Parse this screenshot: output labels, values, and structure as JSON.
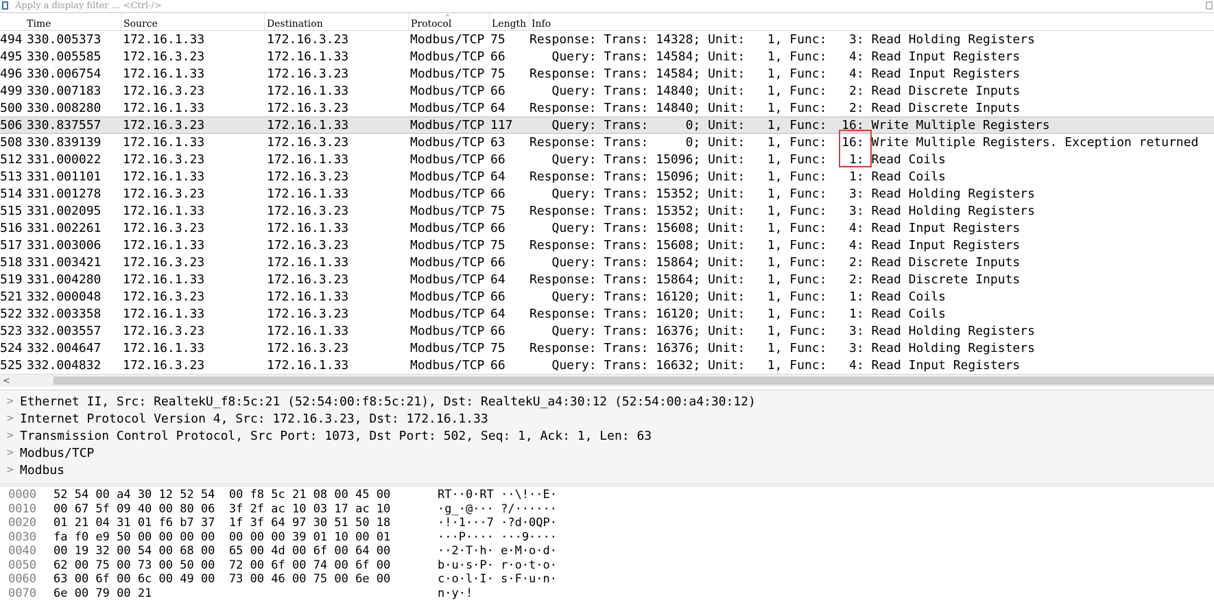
{
  "filter": {
    "placeholder": "Apply a display filter … <Ctrl-/>"
  },
  "columns": [
    "Time",
    "Source",
    "Destination",
    "Protocol",
    "Length",
    "Info"
  ],
  "sort_indicator": "^",
  "packets": [
    {
      "no": "494",
      "time": "330.005373",
      "src": "172.16.1.33",
      "dst": "172.16.3.23",
      "proto": "Modbus/TCP",
      "len": "75",
      "info": "Response: Trans: 14328; Unit:   1, Func:   3: Read Holding Registers"
    },
    {
      "no": "495",
      "time": "330.005585",
      "src": "172.16.3.23",
      "dst": "172.16.1.33",
      "proto": "Modbus/TCP",
      "len": "66",
      "info": "   Query: Trans: 14584; Unit:   1, Func:   4: Read Input Registers"
    },
    {
      "no": "496",
      "time": "330.006754",
      "src": "172.16.1.33",
      "dst": "172.16.3.23",
      "proto": "Modbus/TCP",
      "len": "75",
      "info": "Response: Trans: 14584; Unit:   1, Func:   4: Read Input Registers"
    },
    {
      "no": "499",
      "time": "330.007183",
      "src": "172.16.3.23",
      "dst": "172.16.1.33",
      "proto": "Modbus/TCP",
      "len": "66",
      "info": "   Query: Trans: 14840; Unit:   1, Func:   2: Read Discrete Inputs"
    },
    {
      "no": "500",
      "time": "330.008280",
      "src": "172.16.1.33",
      "dst": "172.16.3.23",
      "proto": "Modbus/TCP",
      "len": "64",
      "info": "Response: Trans: 14840; Unit:   1, Func:   2: Read Discrete Inputs"
    },
    {
      "no": "506",
      "time": "330.837557",
      "src": "172.16.3.23",
      "dst": "172.16.1.33",
      "proto": "Modbus/TCP",
      "len": "117",
      "info": "   Query: Trans:     0; Unit:   1, Func:  16: Write Multiple Registers",
      "selected": true
    },
    {
      "no": "508",
      "time": "330.839139",
      "src": "172.16.1.33",
      "dst": "172.16.3.23",
      "proto": "Modbus/TCP",
      "len": "63",
      "info": "Response: Trans:     0; Unit:   1, Func:  16: Write Multiple Registers. Exception returned"
    },
    {
      "no": "512",
      "time": "331.000022",
      "src": "172.16.3.23",
      "dst": "172.16.1.33",
      "proto": "Modbus/TCP",
      "len": "66",
      "info": "   Query: Trans: 15096; Unit:   1, Func:   1: Read Coils"
    },
    {
      "no": "513",
      "time": "331.001101",
      "src": "172.16.1.33",
      "dst": "172.16.3.23",
      "proto": "Modbus/TCP",
      "len": "64",
      "info": "Response: Trans: 15096; Unit:   1, Func:   1: Read Coils"
    },
    {
      "no": "514",
      "time": "331.001278",
      "src": "172.16.3.23",
      "dst": "172.16.1.33",
      "proto": "Modbus/TCP",
      "len": "66",
      "info": "   Query: Trans: 15352; Unit:   1, Func:   3: Read Holding Registers"
    },
    {
      "no": "515",
      "time": "331.002095",
      "src": "172.16.1.33",
      "dst": "172.16.3.23",
      "proto": "Modbus/TCP",
      "len": "75",
      "info": "Response: Trans: 15352; Unit:   1, Func:   3: Read Holding Registers"
    },
    {
      "no": "516",
      "time": "331.002261",
      "src": "172.16.3.23",
      "dst": "172.16.1.33",
      "proto": "Modbus/TCP",
      "len": "66",
      "info": "   Query: Trans: 15608; Unit:   1, Func:   4: Read Input Registers"
    },
    {
      "no": "517",
      "time": "331.003006",
      "src": "172.16.1.33",
      "dst": "172.16.3.23",
      "proto": "Modbus/TCP",
      "len": "75",
      "info": "Response: Trans: 15608; Unit:   1, Func:   4: Read Input Registers"
    },
    {
      "no": "518",
      "time": "331.003421",
      "src": "172.16.3.23",
      "dst": "172.16.1.33",
      "proto": "Modbus/TCP",
      "len": "66",
      "info": "   Query: Trans: 15864; Unit:   1, Func:   2: Read Discrete Inputs"
    },
    {
      "no": "519",
      "time": "331.004280",
      "src": "172.16.1.33",
      "dst": "172.16.3.23",
      "proto": "Modbus/TCP",
      "len": "64",
      "info": "Response: Trans: 15864; Unit:   1, Func:   2: Read Discrete Inputs"
    },
    {
      "no": "521",
      "time": "332.000048",
      "src": "172.16.3.23",
      "dst": "172.16.1.33",
      "proto": "Modbus/TCP",
      "len": "66",
      "info": "   Query: Trans: 16120; Unit:   1, Func:   1: Read Coils"
    },
    {
      "no": "522",
      "time": "332.003358",
      "src": "172.16.1.33",
      "dst": "172.16.3.23",
      "proto": "Modbus/TCP",
      "len": "64",
      "info": "Response: Trans: 16120; Unit:   1, Func:   1: Read Coils"
    },
    {
      "no": "523",
      "time": "332.003557",
      "src": "172.16.3.23",
      "dst": "172.16.1.33",
      "proto": "Modbus/TCP",
      "len": "66",
      "info": "   Query: Trans: 16376; Unit:   1, Func:   3: Read Holding Registers"
    },
    {
      "no": "524",
      "time": "332.004647",
      "src": "172.16.1.33",
      "dst": "172.16.3.23",
      "proto": "Modbus/TCP",
      "len": "75",
      "info": "Response: Trans: 16376; Unit:   1, Func:   3: Read Holding Registers"
    },
    {
      "no": "525",
      "time": "332.004832",
      "src": "172.16.3.23",
      "dst": "172.16.1.33",
      "proto": "Modbus/TCP",
      "len": "66",
      "info": "   Query: Trans: 16632; Unit:   1, Func:   4: Read Input Registers"
    }
  ],
  "details": [
    "Ethernet II, Src: RealtekU_f8:5c:21 (52:54:00:f8:5c:21), Dst: RealtekU_a4:30:12 (52:54:00:a4:30:12)",
    "Internet Protocol Version 4, Src: 172.16.3.23, Dst: 172.16.1.33",
    "Transmission Control Protocol, Src Port: 1073, Dst Port: 502, Seq: 1, Ack: 1, Len: 63",
    "Modbus/TCP",
    "Modbus"
  ],
  "bytes": [
    {
      "offset": "0000",
      "hex": "52 54 00 a4 30 12 52 54  00 f8 5c 21 08 00 45 00",
      "ascii": "RT··0·RT ··\\!··E·"
    },
    {
      "offset": "0010",
      "hex": "00 67 5f 09 40 00 80 06  3f 2f ac 10 03 17 ac 10",
      "ascii": "·g_·@··· ?/······"
    },
    {
      "offset": "0020",
      "hex": "01 21 04 31 01 f6 b7 37  1f 3f 64 97 30 51 50 18",
      "ascii": "·!·1···7 ·?d·0QP·"
    },
    {
      "offset": "0030",
      "hex": "fa f0 e9 50 00 00 00 00  00 00 00 39 01 10 00 01",
      "ascii": "···P···· ···9····"
    },
    {
      "offset": "0040",
      "hex": "00 19 32 00 54 00 68 00  65 00 4d 00 6f 00 64 00",
      "ascii": "··2·T·h· e·M·o·d·"
    },
    {
      "offset": "0050",
      "hex": "62 00 75 00 73 00 50 00  72 00 6f 00 74 00 6f 00",
      "ascii": "b·u·s·P· r·o·t·o·"
    },
    {
      "offset": "0060",
      "hex": "63 00 6f 00 6c 00 49 00  73 00 46 00 75 00 6e 00",
      "ascii": "c·o·l·I· s·F·u·n·"
    },
    {
      "offset": "0070",
      "hex": "6e 00 79 00 21",
      "ascii": "n·y·!"
    }
  ],
  "colors": {
    "highlight_box": "#e03a3a",
    "selected_row": "#e6e6e6",
    "pane_bg": "#f5f5f5"
  }
}
